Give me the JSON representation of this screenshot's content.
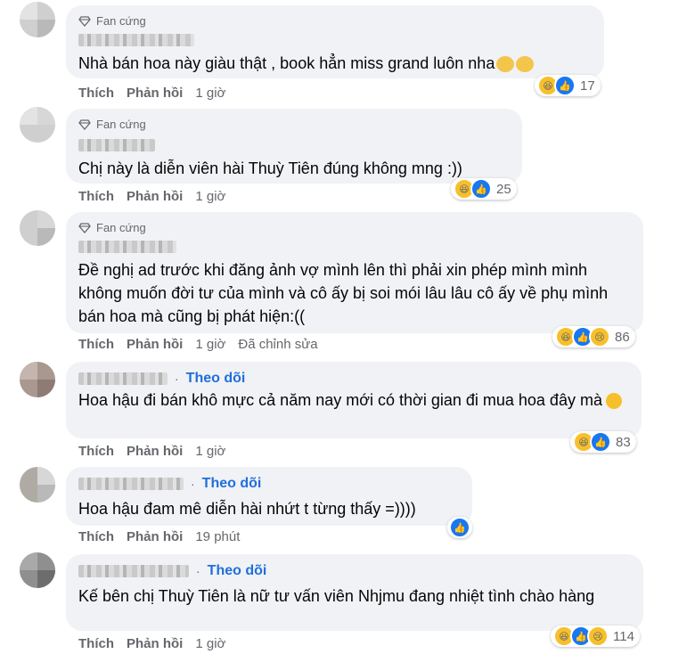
{
  "comments": [
    {
      "badge": "Fan cứng",
      "text": "Nhà bán hoa này giàu thật , book hẳn miss grand luôn nha",
      "actions": {
        "like": "Thích",
        "reply": "Phản hồi",
        "time": "1 giờ"
      },
      "reaction_count": "17"
    },
    {
      "badge": "Fan cứng",
      "text": "Chị này là diễn viên hài Thuỳ Tiên đúng không mng :))",
      "actions": {
        "like": "Thích",
        "reply": "Phản hồi",
        "time": "1 giờ"
      },
      "reaction_count": "25"
    },
    {
      "badge": "Fan cứng",
      "text": "Đề nghị ad trước khi đăng ảnh vợ mình lên thì phải xin phép mình mình không muốn đời tư của mình và cô ấy bị soi mói lâu lâu cô ấy về phụ mình bán hoa mà cũng bị phát hiện:((",
      "actions": {
        "like": "Thích",
        "reply": "Phản hồi",
        "time": "1 giờ",
        "edited": "Đã chỉnh sửa"
      },
      "reaction_count": "86"
    },
    {
      "follow": "Theo dõi",
      "text": "Hoa hậu đi bán khô mực cả năm nay mới có thời gian đi mua hoa đây mà",
      "actions": {
        "like": "Thích",
        "reply": "Phản hồi",
        "time": "1 giờ"
      },
      "reaction_count": "83"
    },
    {
      "follow": "Theo dõi",
      "text": "Hoa hậu đam mê diễn hài nhứt t từng thấy =))))",
      "actions": {
        "like": "Thích",
        "reply": "Phản hồi",
        "time": "19 phút"
      }
    },
    {
      "follow": "Theo dõi",
      "text": "Kế bên chị Thuỳ Tiên là nữ tư vấn viên Nhjmu đang nhiệt tình chào hàng",
      "actions": {
        "like": "Thích",
        "reply": "Phản hồi",
        "time": "1 giờ"
      },
      "reaction_count": "114"
    }
  ],
  "dot": "·",
  "colors": {
    "follow": "#216fdb",
    "bubble": "#f0f2f5",
    "meta": "#65676b",
    "like": "#1877f2",
    "haha": "#f7c02b"
  },
  "icons": {
    "badge": "diamond-icon",
    "reactions": [
      "haha-icon",
      "like-icon",
      "sad-icon"
    ]
  }
}
